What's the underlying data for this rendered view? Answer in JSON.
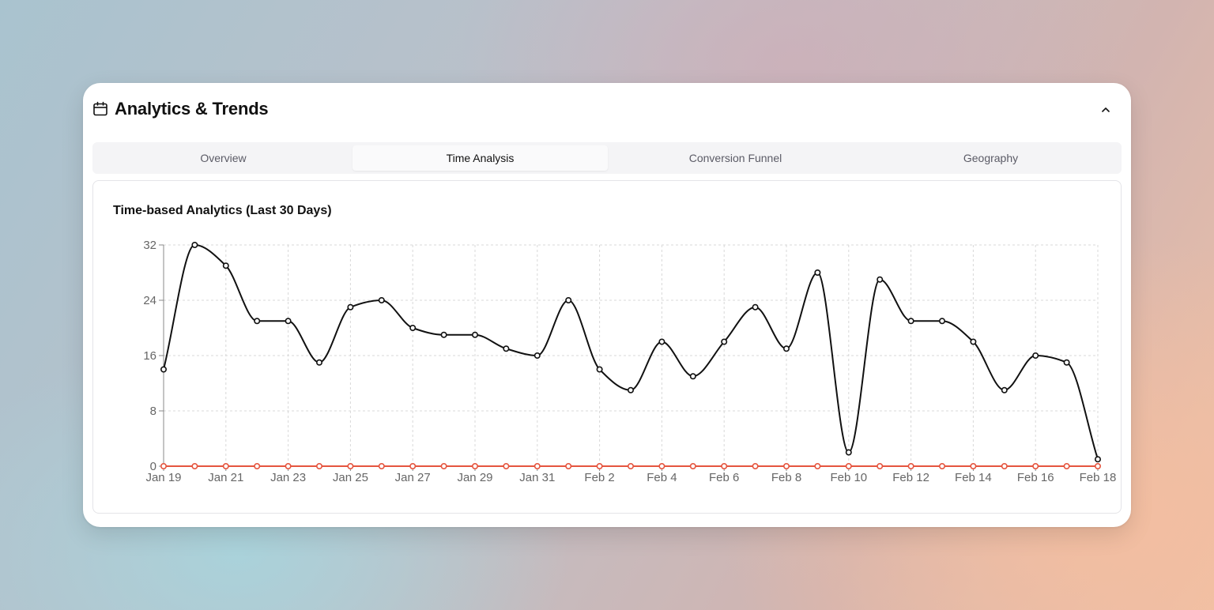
{
  "header": {
    "title": "Analytics & Trends",
    "icon": "calendar-icon",
    "collapse_icon": "chevron-up-icon"
  },
  "tabs": [
    {
      "label": "Overview",
      "active": false
    },
    {
      "label": "Time Analysis",
      "active": true
    },
    {
      "label": "Conversion Funnel",
      "active": false
    },
    {
      "label": "Geography",
      "active": false
    }
  ],
  "panel": {
    "title": "Time-based Analytics (Last 30 Days)"
  },
  "chart_data": {
    "type": "line",
    "x": [
      "Jan 19",
      "Jan 20",
      "Jan 21",
      "Jan 22",
      "Jan 23",
      "Jan 24",
      "Jan 25",
      "Jan 26",
      "Jan 27",
      "Jan 28",
      "Jan 29",
      "Jan 30",
      "Jan 31",
      "Feb 1",
      "Feb 2",
      "Feb 3",
      "Feb 4",
      "Feb 5",
      "Feb 6",
      "Feb 7",
      "Feb 8",
      "Feb 9",
      "Feb 10",
      "Feb 11",
      "Feb 12",
      "Feb 13",
      "Feb 14",
      "Feb 15",
      "Feb 16",
      "Feb 17",
      "Feb 18"
    ],
    "xticks": [
      "Jan 19",
      "Jan 21",
      "Jan 23",
      "Jan 25",
      "Jan 27",
      "Jan 29",
      "Jan 31",
      "Feb 2",
      "Feb 4",
      "Feb 6",
      "Feb 8",
      "Feb 10",
      "Feb 12",
      "Feb 14",
      "Feb 16",
      "Feb 18"
    ],
    "series": [
      {
        "color": "#111111",
        "values": [
          14,
          32,
          29,
          21,
          21,
          15,
          23,
          24,
          20,
          19,
          19,
          17,
          16,
          24,
          14,
          11,
          18,
          13,
          18,
          23,
          17,
          28,
          2,
          27,
          21,
          21,
          18,
          11,
          16,
          15,
          1
        ]
      },
      {
        "color": "#e5553f",
        "values": [
          0,
          0,
          0,
          0,
          0,
          0,
          0,
          0,
          0,
          0,
          0,
          0,
          0,
          0,
          0,
          0,
          0,
          0,
          0,
          0,
          0,
          0,
          0,
          0,
          0,
          0,
          0,
          0,
          0,
          0,
          0
        ]
      }
    ],
    "ylim": [
      0,
      32
    ],
    "yticks": [
      0,
      8,
      16,
      24,
      32
    ],
    "grid": true,
    "curve": "smooth"
  }
}
